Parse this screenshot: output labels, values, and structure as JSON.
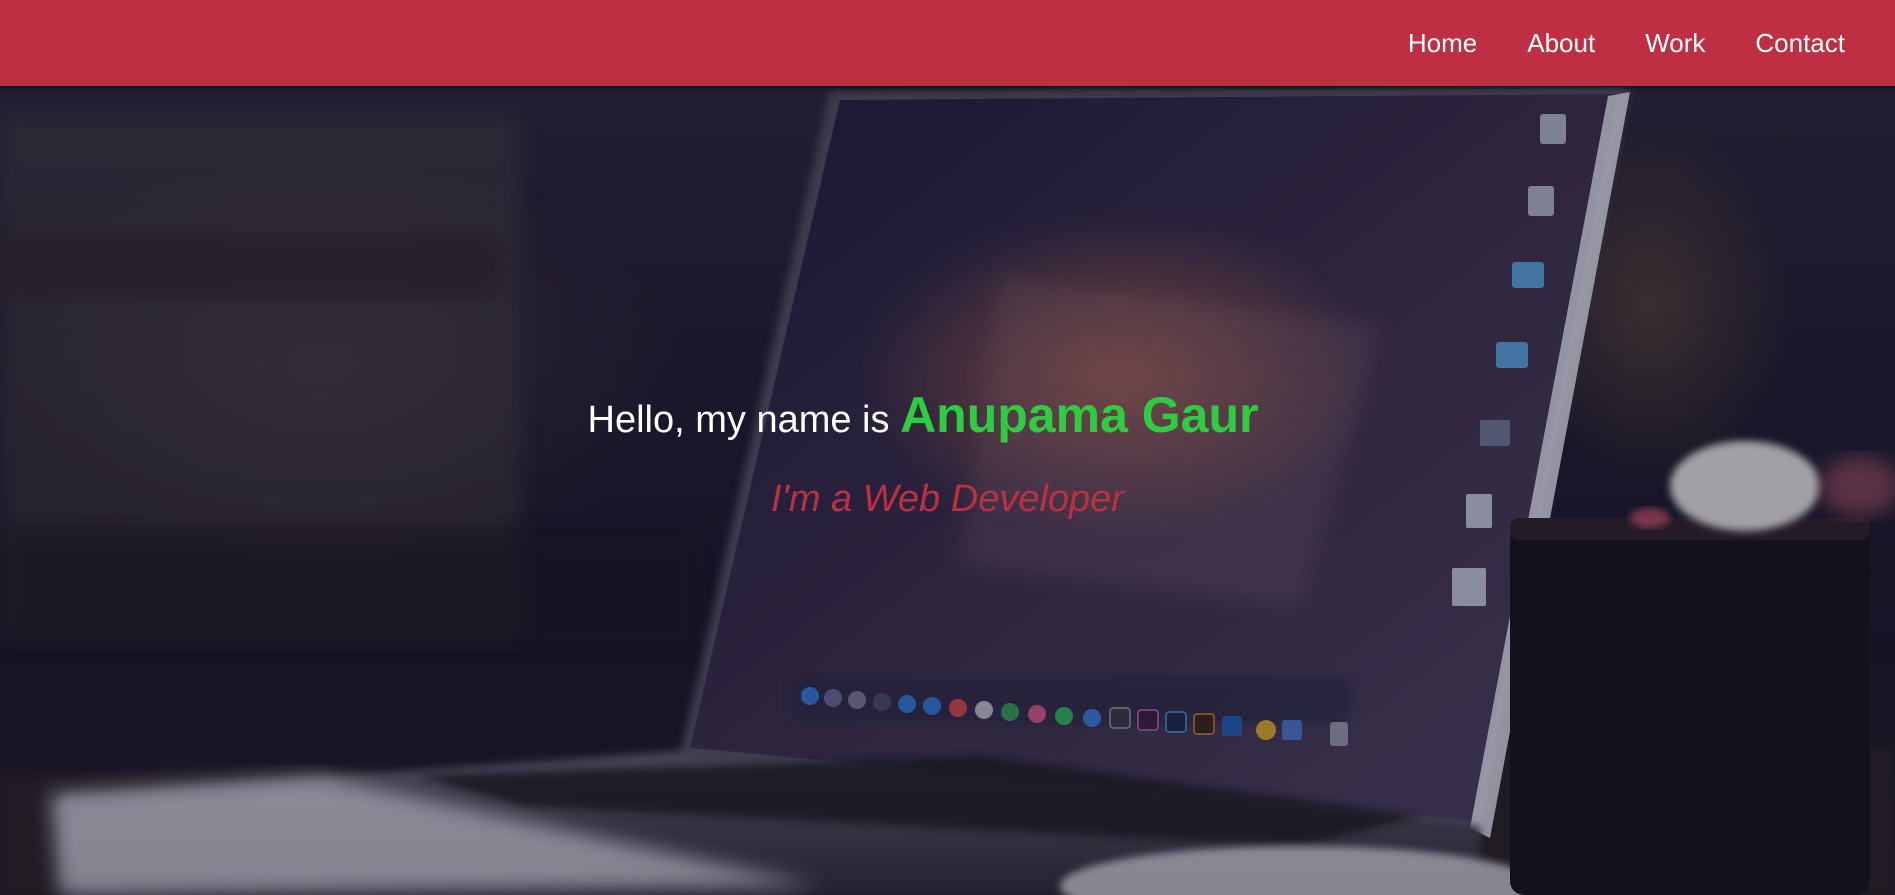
{
  "nav": {
    "items": [
      {
        "label": "Home"
      },
      {
        "label": "About"
      },
      {
        "label": "Work"
      },
      {
        "label": "Contact"
      }
    ],
    "background_color": "#be2f43"
  },
  "hero": {
    "greeting": "Hello, my name is ",
    "name": "Anupama Gaur",
    "tagline": "I'm a Web Developer",
    "name_color": "#2ecc40",
    "tagline_color": "#be2f43",
    "background_image": "blurred photo of a laptop on a desk with a coffee cup"
  }
}
